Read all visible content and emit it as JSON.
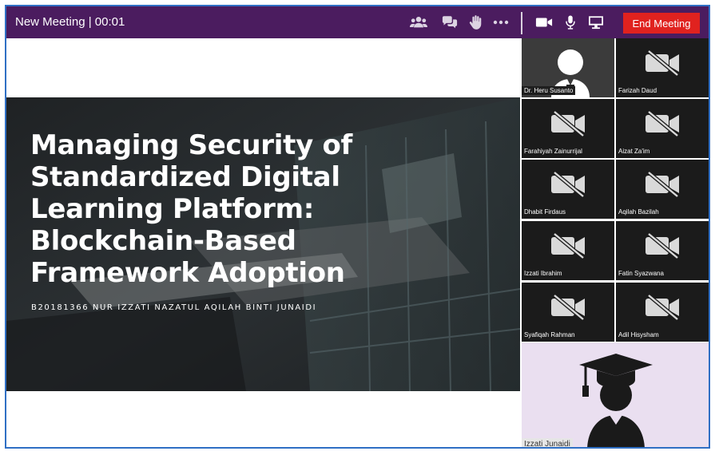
{
  "meeting": {
    "title": "New Meeting | 00:01",
    "end_label": "End Meeting",
    "toolbar_icons": [
      "participants-icon",
      "chat-icon",
      "raise-hand-icon",
      "more-icon",
      "camera-icon",
      "microphone-icon",
      "screen-share-icon"
    ]
  },
  "slide": {
    "title": "Managing Security of Standardized Digital Learning Platform: Blockchain-Based Framework Adoption",
    "subtitle": "B20181366 NUR IZZATI NAZATUL AQILAH BINTI JUNAIDI"
  },
  "participants": [
    {
      "name": "Dr. Heru Susanto",
      "video": "avatar"
    },
    {
      "name": "Farizah Daud",
      "video": "off"
    },
    {
      "name": "Farahiyah Zainurrijal",
      "video": "off"
    },
    {
      "name": "Aizat Za'im",
      "video": "off"
    },
    {
      "name": "Dhabit Firdaus",
      "video": "off"
    },
    {
      "name": "Aqilah Bazilah",
      "video": "off"
    },
    {
      "name": "Izzati Ibrahim",
      "video": "off"
    },
    {
      "name": "Fatin Syazwana",
      "video": "off"
    },
    {
      "name": "Syafiqah Rahman",
      "video": "off"
    },
    {
      "name": "Adil Hisysham",
      "video": "off"
    }
  ],
  "self_view": {
    "name": "Izzati Junaidi",
    "icon": "graduate-icon"
  },
  "colors": {
    "topbar": "#4b1c5f",
    "end_button": "#e0221f",
    "frame_border": "#2f6fc4",
    "tile_bg": "#1b1b1b",
    "self_view_bg": "#eadff0"
  }
}
